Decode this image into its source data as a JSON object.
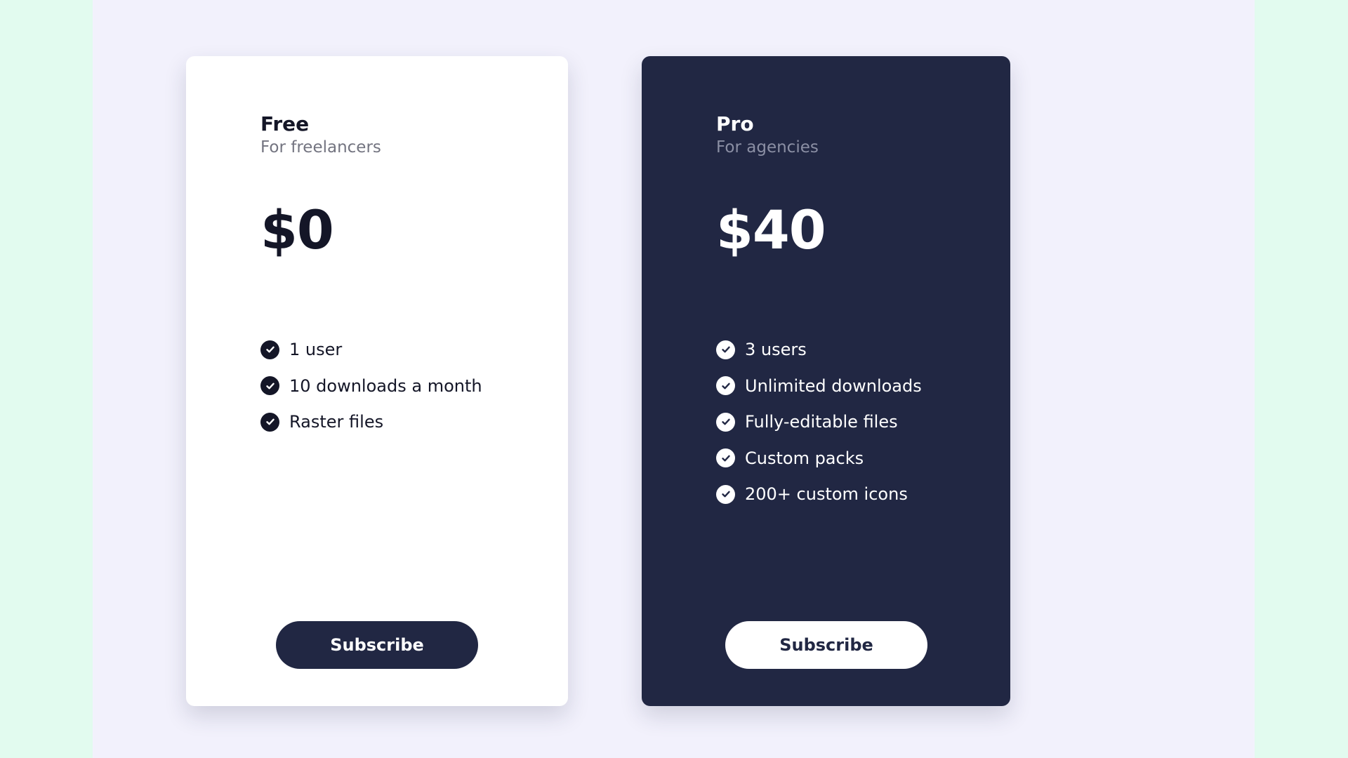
{
  "colors": {
    "outer_background": "#e2fbef",
    "panel_background": "#f2f1fc",
    "navy": "#212743",
    "white": "#ffffff"
  },
  "plans": [
    {
      "name": "Free",
      "subtitle": "For freelancers",
      "price": "$0",
      "features": [
        "1 user",
        "10 downloads a month",
        "Raster files"
      ],
      "button_label": "Subscribe",
      "feature_icon": "check-circle-icon"
    },
    {
      "name": "Pro",
      "subtitle": "For agencies",
      "price": "$40",
      "features": [
        "3 users",
        "Unlimited downloads",
        "Fully-editable files",
        "Custom packs",
        "200+ custom icons"
      ],
      "button_label": "Subscribe",
      "feature_icon": "check-circle-icon"
    }
  ]
}
